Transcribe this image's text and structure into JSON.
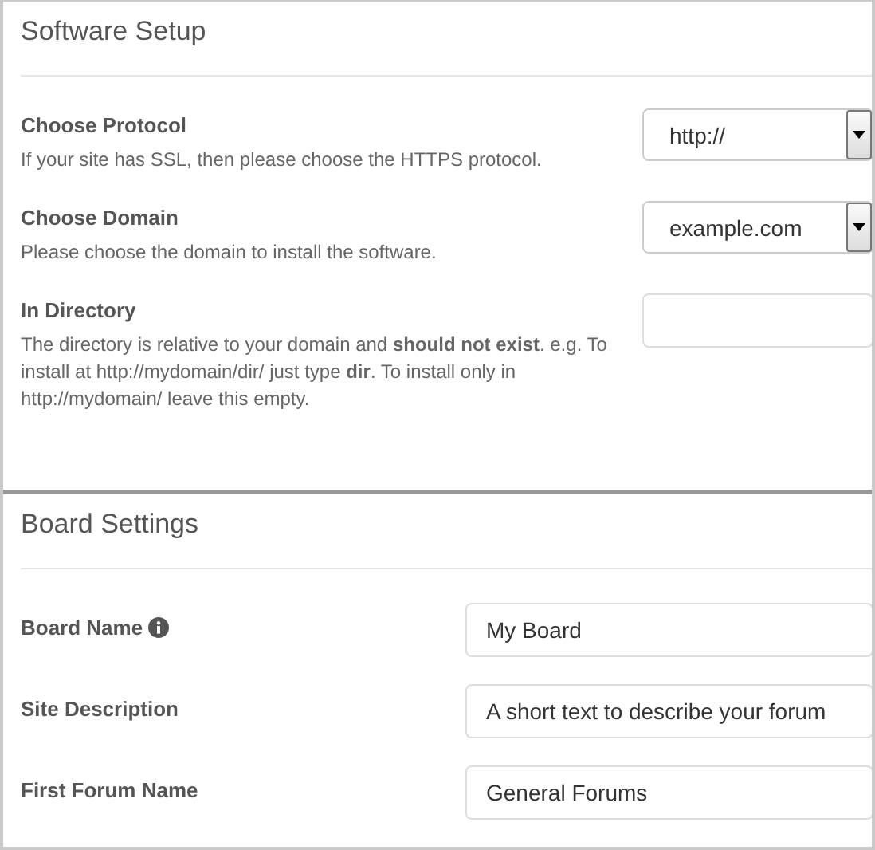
{
  "sections": [
    {
      "title": "Software Setup",
      "fields": [
        {
          "kind": "select",
          "label": "Choose Protocol",
          "help": "If your site has SSL, then please choose the HTTPS protocol.",
          "value": "http://"
        },
        {
          "kind": "select",
          "label": "Choose Domain",
          "help": "Please choose the domain to install the software.",
          "value": "example.com"
        },
        {
          "kind": "text",
          "label": "In Directory",
          "help": "The directory is relative to your domain and **should not exist**. e.g. To install at http://mydomain/dir/ just type **dir**. To install only in http://mydomain/ leave this empty."
        }
      ]
    },
    {
      "title": "Board Settings",
      "fields": [
        {
          "kind": "text",
          "label": "Board Name",
          "info": true,
          "value": "My Board"
        },
        {
          "kind": "text",
          "label": "Site Description",
          "value": "A short text to describe your forum"
        },
        {
          "kind": "text",
          "label": "First Forum Name",
          "value": "General Forums"
        }
      ]
    }
  ]
}
